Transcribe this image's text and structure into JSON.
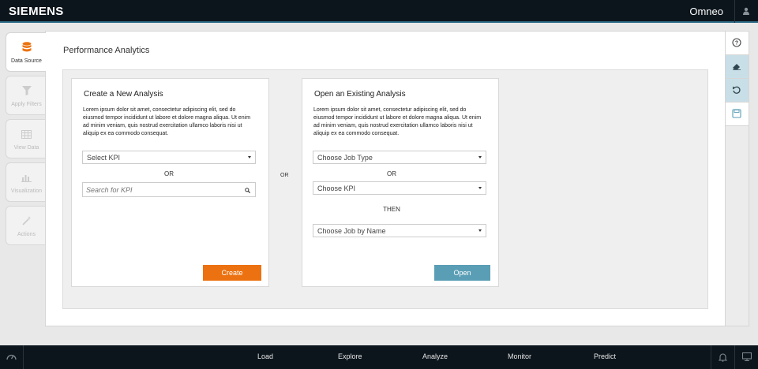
{
  "header": {
    "brand": "SIEMENS",
    "app_name": "Omneo",
    "user_icon": "user-icon"
  },
  "sidebar": {
    "tabs": [
      {
        "label": "Data Source",
        "icon": "database-icon",
        "active": true
      },
      {
        "label": "Apply Filters",
        "icon": "filter-icon",
        "active": false
      },
      {
        "label": "View Data",
        "icon": "table-icon",
        "active": false
      },
      {
        "label": "Visualization",
        "icon": "bar-chart-icon",
        "active": false
      },
      {
        "label": "Actions",
        "icon": "wand-icon",
        "active": false
      }
    ]
  },
  "main": {
    "title": "Performance Analytics",
    "or_between": "OR",
    "new_analysis": {
      "title": "Create a New Analysis",
      "description": "Lorem ipsum dolor sit amet, consectetur adipiscing elit, sed do eiusmod tempor incididunt ut labore et dolore magna aliqua. Ut enim ad minim veniam, quis nostrud exercitation ullamco laboris nisi ut aliquip ex ea commodo consequat.",
      "select_kpi": "Select KPI",
      "or": "OR",
      "search_placeholder": "Search for KPI",
      "create_label": "Create"
    },
    "existing_analysis": {
      "title": "Open an Existing Analysis",
      "description": "Lorem ipsum dolor sit amet, consectetur adipiscing elit, sed do eiusmod tempor incididunt ut labore et dolore magna aliqua. Ut enim ad minim veniam, quis nostrud exercitation ullamco laboris nisi ut aliquip ex ea commodo consequat.",
      "job_type": "Choose Job Type",
      "or": "OR",
      "kpi": "Choose KPI",
      "then": "THEN",
      "job_name": "Choose Job by Name",
      "open_label": "Open"
    }
  },
  "right_toolbar": {
    "buttons": [
      {
        "icon": "help-icon"
      },
      {
        "icon": "eraser-icon"
      },
      {
        "icon": "undo-icon"
      },
      {
        "icon": "save-icon"
      }
    ]
  },
  "footer": {
    "nav": [
      "Load",
      "Explore",
      "Analyze",
      "Monitor",
      "Predict"
    ],
    "left_icon": "dashboard-icon",
    "right_icons": [
      "bell-icon",
      "monitor-icon"
    ]
  },
  "colors": {
    "accent_orange": "#ec7211",
    "accent_blue": "#5a9eb5",
    "topbar": "#0c151c"
  }
}
